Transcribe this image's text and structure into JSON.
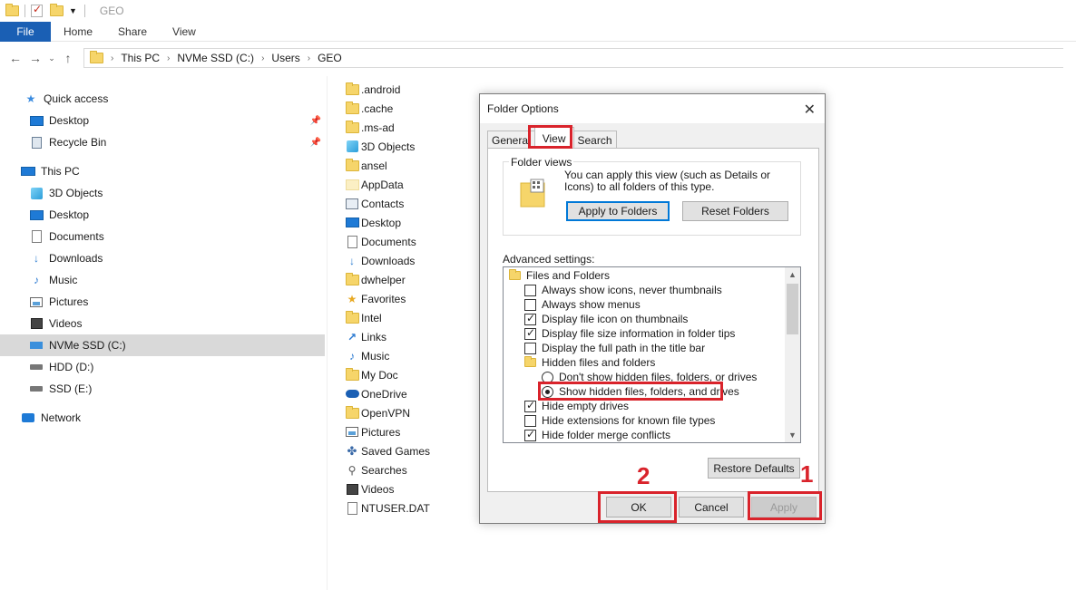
{
  "window": {
    "title": "GEO"
  },
  "ribbon": {
    "file": "File",
    "tabs": [
      "Home",
      "Share",
      "View"
    ]
  },
  "address": {
    "crumbs": [
      "This PC",
      "NVMe SSD (C:)",
      "Users",
      "GEO"
    ]
  },
  "nav": {
    "quick_access": "Quick access",
    "qa_items": [
      "Desktop",
      "Recycle Bin"
    ],
    "this_pc": "This PC",
    "pc_items": [
      "3D Objects",
      "Desktop",
      "Documents",
      "Downloads",
      "Music",
      "Pictures",
      "Videos",
      "NVMe SSD (C:)",
      "HDD (D:)",
      "SSD (E:)"
    ],
    "network": "Network"
  },
  "files": [
    ".android",
    ".cache",
    ".ms-ad",
    "3D Objects",
    "ansel",
    "AppData",
    "Contacts",
    "Desktop",
    "Documents",
    "Downloads",
    "dwhelper",
    "Favorites",
    "Intel",
    "Links",
    "Music",
    "My Doc",
    "OneDrive",
    "OpenVPN",
    "Pictures",
    "Saved Games",
    "Searches",
    "Videos",
    "NTUSER.DAT"
  ],
  "dialog": {
    "title": "Folder Options",
    "tabs": [
      "General",
      "View",
      "Search"
    ],
    "folder_views_label": "Folder views",
    "folder_views_text": "You can apply this view (such as Details or Icons) to all folders of this type.",
    "apply_to_folders": "Apply to Folders",
    "reset_folders": "Reset Folders",
    "advanced_label": "Advanced settings:",
    "tree": {
      "root": "Files and Folders",
      "items": [
        {
          "label": "Always show icons, never thumbnails",
          "checked": false
        },
        {
          "label": "Always show menus",
          "checked": false
        },
        {
          "label": "Display file icon on thumbnails",
          "checked": true
        },
        {
          "label": "Display file size information in folder tips",
          "checked": true
        },
        {
          "label": "Display the full path in the title bar",
          "checked": false
        }
      ],
      "hidden_group": "Hidden files and folders",
      "radio_dont_show": "Don't show hidden files, folders, or drives",
      "radio_show": "Show hidden files, folders, and drives",
      "items_after": [
        {
          "label": "Hide empty drives",
          "checked": true
        },
        {
          "label": "Hide extensions for known file types",
          "checked": false
        },
        {
          "label": "Hide folder merge conflicts",
          "checked": true
        }
      ]
    },
    "restore_defaults": "Restore Defaults",
    "ok": "OK",
    "cancel": "Cancel",
    "apply": "Apply"
  },
  "annotations": {
    "step1": "1",
    "step2": "2"
  },
  "colors": {
    "accent": "#1a5fb4",
    "annotation": "#d9232b"
  }
}
